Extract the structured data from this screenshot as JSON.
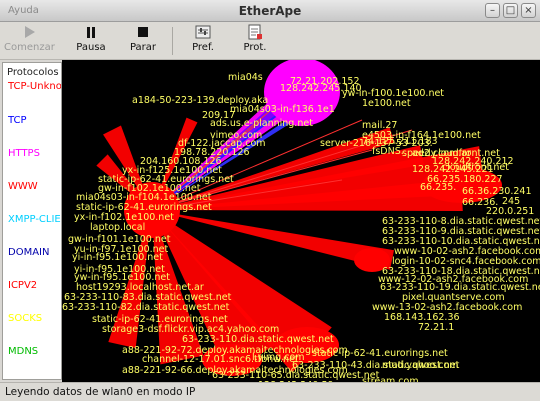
{
  "window": {
    "title": "EtherApe",
    "ghost_title": "Ayuda"
  },
  "toolbar": {
    "start_label": "Comenzar",
    "pause_label": "Pausa",
    "stop_label": "Parar",
    "prefs_label": "Pref.",
    "prot_label": "Prot."
  },
  "protocols": {
    "header": "Protocolos",
    "items": [
      {
        "label": "TCP-Unknown",
        "color": "#ff0000"
      },
      {
        "label": "TCP",
        "color": "#0000ff"
      },
      {
        "label": "HTTPS",
        "color": "#ff00ff"
      },
      {
        "label": "WWW",
        "color": "#ff0000"
      },
      {
        "label": "XMPP-CLIENT",
        "color": "#00cfff"
      },
      {
        "label": "DOMAIN",
        "color": "#0000aa"
      },
      {
        "label": "ICPV2",
        "color": "#ff0000"
      },
      {
        "label": "SOCKS",
        "color": "#ffff00"
      },
      {
        "label": "MDNS",
        "color": "#00bb00"
      }
    ]
  },
  "graph": {
    "label_color": "#ffff66",
    "labels": [
      "mia04s",
      "72.21.202.152",
      "128.242.245.140",
      "a184-50-223-139.deploy.aka",
      "mia04s03-in-f136.1e1",
      "209.17",
      "ads.us.e-planning.net",
      "vimeo.com",
      "df-122.jaccap.com",
      "198.78.220.126",
      "204.160.108.126",
      "yx-in-f125.1e100.net",
      "static-ip-62-41.eurorings.net",
      "gw-in-f102.1e100.net",
      "mia04s03-in-f104.1e100.net",
      "static-ip-62-41.eurorings.net",
      "yx-in-f102.1e100.net",
      "laptop.local",
      "gw-in-f101.1e100.net",
      "yu-in-f97.1e100.net",
      "yi-in-f95.1e100.net",
      "yi-in-f95.1e100.net",
      "yw-in-f95.1e100.net",
      "host19293.localhost.net.ar",
      "63-233-110-83.dia.static.qwest.net",
      "63-233-110-82.dia.static.qwest.net",
      "static-ip-62-41.eurorings.net",
      "storage3-dsf.flickr.vip.ac4.yahoo.com",
      "63-233-110.dia.static.qwest.net",
      "a88-221-92-72.deploy.akamaitechnologies.com",
      "channel-12-17.01.snc6.tfbnw.net",
      "a88-221-92-66.deploy.akamaitechnologies.com",
      "63-233-110-65.dia.static.qwest.net",
      "l.yimg.com",
      "63-233-110-43.dia.static.qwest.net",
      "static-ip-62-41.eurorings.net",
      "mud.yahoo.com",
      "stream.com",
      "128.242.240.59",
      "yw-in-f100.1e100.net",
      "1e100.net",
      "mail.27",
      "e4503-in-f164.1e100.net",
      "74.125.211.183",
      "ad2.cloudfront.net",
      "server-216-137-53-203.",
      "speedy.com.ar",
      "fsDNS.",
      "128.242.240.212",
      "128.242.245.221",
      "66.235.180.227",
      "66.235.",
      "66.36.230.241",
      "66.236.",
      "245",
      "220.0.251",
      "63-233-110-8.dia.static.qwest.net",
      "63-233-110-9.dia.static.qwest.net",
      "63-233-110-10.dia.static.qwest.net",
      "www-10-02-ash2.facebook.com",
      "login-10-02-snc4.facebook.com",
      "63-233-110-18.dia.static.qwest.net",
      "www-12-02-ash2.facebook.com",
      "63-233-110-19.dia.static.qwest.net",
      "pixel.quantserve.com",
      "www-13-02-ash2.facebook.com",
      "168.143.162.36",
      "72.21.1",
      "cloudfront.net"
    ]
  },
  "status": {
    "text": "Leyendo datos de wlan0 en modo IP"
  }
}
